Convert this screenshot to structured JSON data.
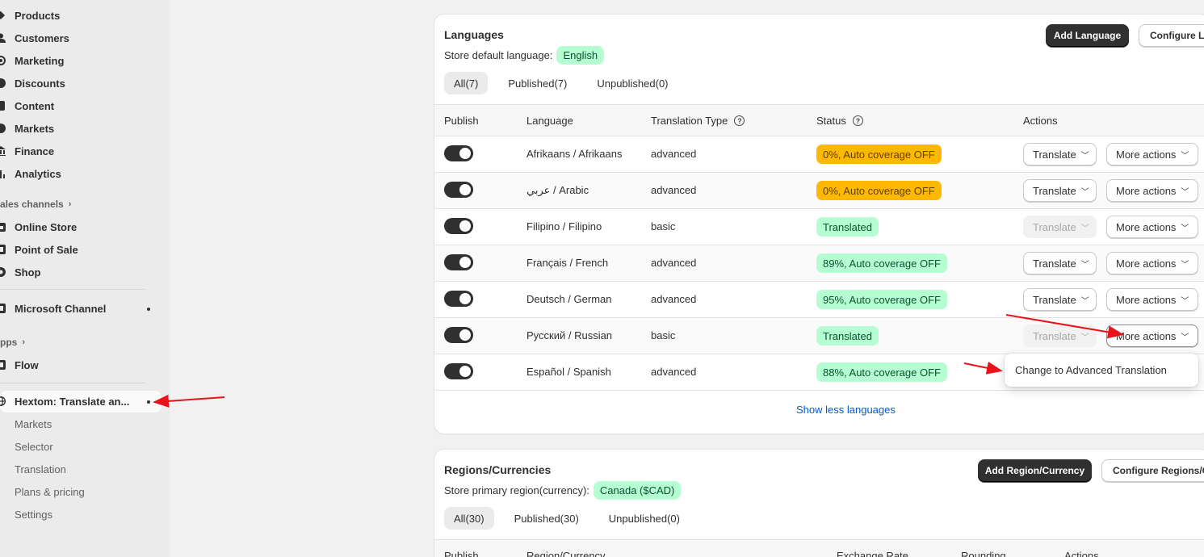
{
  "sidebar": {
    "items": [
      {
        "label": "Products",
        "icon": "tag-icon"
      },
      {
        "label": "Customers",
        "icon": "person-icon"
      },
      {
        "label": "Marketing",
        "icon": "target-icon"
      },
      {
        "label": "Discounts",
        "icon": "discount-icon"
      },
      {
        "label": "Content",
        "icon": "file-icon"
      },
      {
        "label": "Markets",
        "icon": "globe-icon"
      },
      {
        "label": "Finance",
        "icon": "bank-icon"
      },
      {
        "label": "Analytics",
        "icon": "chart-icon"
      }
    ],
    "sales_channels_title": "ales channels",
    "channels": [
      {
        "label": "Online Store"
      },
      {
        "label": "Point of Sale"
      },
      {
        "label": "Shop"
      }
    ],
    "microsoft_channel": "Microsoft Channel",
    "apps_title": "pps",
    "flow": "Flow",
    "hextom": "Hextom: Translate an...",
    "hextom_sub": [
      "Markets",
      "Selector",
      "Translation",
      "Plans & pricing",
      "Settings"
    ]
  },
  "languages": {
    "title": "Languages",
    "add_button": "Add Language",
    "configure_button": "Configure Languages",
    "store_default_label": "Store default language:",
    "store_default_value": "English",
    "tabs": [
      "All(7)",
      "Published(7)",
      "Unpublished(0)"
    ],
    "headers": {
      "publish": "Publish",
      "language": "Language",
      "type": "Translation Type",
      "status": "Status",
      "actions": "Actions"
    },
    "rows": [
      {
        "language": "Afrikaans / Afrikaans",
        "type": "advanced",
        "status": "0%, Auto coverage OFF",
        "status_kind": "warn",
        "translate": "Translate",
        "more": "More actions",
        "translate_disabled": false
      },
      {
        "language": "عربي / Arabic",
        "type": "advanced",
        "status": "0%, Auto coverage OFF",
        "status_kind": "warn",
        "translate": "Translate",
        "more": "More actions",
        "translate_disabled": false
      },
      {
        "language": "Filipino / Filipino",
        "type": "basic",
        "status": "Translated",
        "status_kind": "ok",
        "translate": "Translate",
        "more": "More actions",
        "translate_disabled": true
      },
      {
        "language": "Français / French",
        "type": "advanced",
        "status": "89%, Auto coverage OFF",
        "status_kind": "ok",
        "translate": "Translate",
        "more": "More actions",
        "translate_disabled": false
      },
      {
        "language": "Deutsch / German",
        "type": "advanced",
        "status": "95%, Auto coverage OFF",
        "status_kind": "ok",
        "translate": "Translate",
        "more": "More actions",
        "translate_disabled": false
      },
      {
        "language": "Русский / Russian",
        "type": "basic",
        "status": "Translated",
        "status_kind": "ok",
        "translate": "Translate",
        "more": "More actions",
        "translate_disabled": true
      },
      {
        "language": "Español / Spanish",
        "type": "advanced",
        "status": "88%, Auto coverage OFF",
        "status_kind": "ok",
        "translate": "Translate",
        "more": "More actions",
        "translate_disabled": false
      }
    ],
    "show_less": "Show less languages",
    "dropdown_item": "Change to Advanced Translation"
  },
  "regions": {
    "title": "Regions/Currencies",
    "add_button": "Add Region/Currency",
    "configure_button": "Configure Regions/Currencies",
    "store_primary_label": "Store primary region(currency):",
    "store_primary_value": "Canada ($CAD)",
    "tabs": [
      "All(30)",
      "Published(30)",
      "Unpublished(0)"
    ],
    "headers": {
      "publish": "Publish",
      "region": "Region/Currency",
      "rate": "Exchange Rate",
      "rounding": "Rounding",
      "actions": "Actions"
    }
  },
  "colors": {
    "accent_link": "#005bd3",
    "annotation_arrow": "#e8131b"
  }
}
